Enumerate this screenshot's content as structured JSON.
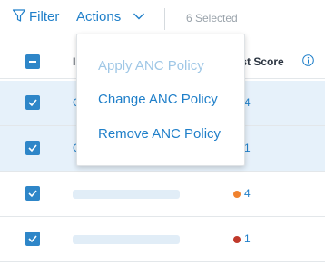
{
  "toolbar": {
    "filter_label": "Filter",
    "actions_label": "Actions",
    "selected_text": "6 Selected"
  },
  "table": {
    "header": {
      "col1": "I",
      "col2": "ust Score"
    },
    "rows": [
      {
        "selected": true,
        "score": "4",
        "dot_color": "",
        "partial_text": "C"
      },
      {
        "selected": true,
        "score": "1",
        "dot_color": "",
        "partial_text": "C"
      },
      {
        "selected": true,
        "score": "4",
        "dot_color": "#f0822e",
        "partial_text": ""
      },
      {
        "selected": true,
        "score": "1",
        "dot_color": "#c0392b",
        "partial_text": ""
      }
    ]
  },
  "actions_menu": {
    "items": [
      {
        "label": "Apply ANC Policy",
        "enabled": false
      },
      {
        "label": "Change ANC Policy",
        "enabled": true
      },
      {
        "label": "Remove ANC Policy",
        "enabled": true
      }
    ]
  },
  "colors": {
    "accent": "#1f7fc9",
    "checkbox": "#2e86c8",
    "selected_row": "#e6f1fa",
    "disabled_text": "#9fc7e6"
  },
  "icons": [
    "filter-icon",
    "chevron-down-icon",
    "info-icon",
    "checkmark-icon"
  ]
}
